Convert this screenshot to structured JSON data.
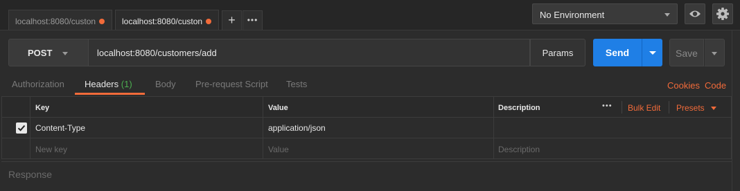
{
  "tabs": [
    {
      "label": "localhost:8080/custon",
      "active": false
    },
    {
      "label": "localhost:8080/custon",
      "active": true
    }
  ],
  "environment": {
    "selected": "No Environment"
  },
  "request": {
    "method": "POST",
    "url": "localhost:8080/customers/add",
    "params_label": "Params",
    "send_label": "Send",
    "save_label": "Save"
  },
  "subtabs": {
    "authorization": "Authorization",
    "headers": "Headers",
    "headers_count": "(1)",
    "body": "Body",
    "prerequest": "Pre-request Script",
    "tests": "Tests",
    "cookies": "Cookies",
    "code": "Code"
  },
  "headers_table": {
    "col_key": "Key",
    "col_value": "Value",
    "col_description": "Description",
    "more": "•••",
    "bulk_edit": "Bulk Edit",
    "presets": "Presets",
    "rows": [
      {
        "checked": true,
        "key": "Content-Type",
        "value": "application/json",
        "description": ""
      }
    ],
    "new_row": {
      "key_placeholder": "New key",
      "value_placeholder": "Value",
      "description_placeholder": "Description"
    }
  },
  "response": {
    "label": "Response"
  },
  "colors": {
    "accent": "#f26b3a",
    "send": "#1f7fe6",
    "count": "#4caf50"
  }
}
